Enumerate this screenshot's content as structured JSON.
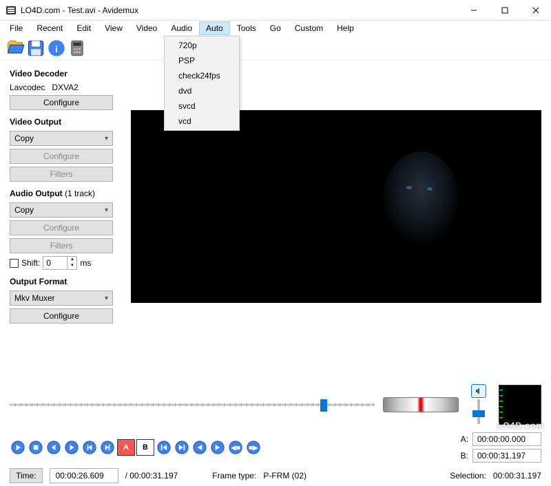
{
  "window": {
    "title": "LO4D.com - Test.avi - Avidemux"
  },
  "menubar": {
    "items": [
      "File",
      "Recent",
      "Edit",
      "View",
      "Video",
      "Audio",
      "Auto",
      "Tools",
      "Go",
      "Custom",
      "Help"
    ],
    "active_index": 6
  },
  "dropdown": {
    "items": [
      "720p",
      "PSP",
      "check24fps",
      "dvd",
      "svcd",
      "vcd"
    ]
  },
  "toolbar_icons": [
    "open-icon",
    "save-icon",
    "info-icon",
    "calculator-icon"
  ],
  "sidebar": {
    "video_decoder": {
      "label": "Video Decoder",
      "codec": "Lavcodec",
      "accel": "DXVA2",
      "configure": "Configure"
    },
    "video_output": {
      "label": "Video Output",
      "mode": "Copy",
      "configure": "Configure",
      "filters": "Filters"
    },
    "audio_output": {
      "label": "Audio Output",
      "tracks": "(1 track)",
      "mode": "Copy",
      "configure": "Configure",
      "filters": "Filters",
      "shift_label": "Shift:",
      "shift_value": "0",
      "shift_unit": "ms"
    },
    "output_format": {
      "label": "Output Format",
      "muxer": "Mkv Muxer",
      "configure": "Configure"
    }
  },
  "slider": {
    "position_pct": 85
  },
  "ab": {
    "a_label": "A:",
    "a_value": "00:00:00.000",
    "b_label": "B:",
    "b_value": "00:00:31.197"
  },
  "status": {
    "time_label": "Time:",
    "time_value": "00:00:26.609",
    "duration": "/ 00:00:31.197",
    "frametype_label": "Frame type:",
    "frametype_value": "P-FRM (02)",
    "selection_label": "Selection:",
    "selection_value": "00:00:31.197"
  },
  "watermark": "LO4D.com",
  "colors": {
    "accent": "#0078d7",
    "button_bg": "#e1e1e1",
    "highlight": "#cce8ff"
  }
}
